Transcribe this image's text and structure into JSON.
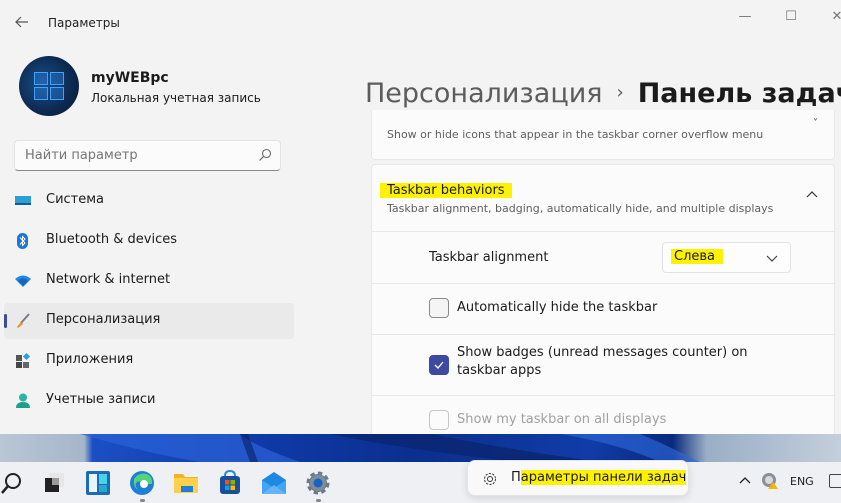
{
  "window": {
    "title": "Параметры",
    "controls": {
      "minimize": "—",
      "maximize": "☐",
      "close": "✕"
    }
  },
  "profile": {
    "name": "myWEBpc",
    "account_type": "Локальная учетная запись"
  },
  "search": {
    "placeholder": "Найти параметр",
    "value": ""
  },
  "sidebar": {
    "items": [
      {
        "label": "Система",
        "icon": "system-icon",
        "active": false
      },
      {
        "label": "Bluetooth & devices",
        "icon": "bluetooth-icon",
        "active": false
      },
      {
        "label": "Network & internet",
        "icon": "wifi-icon",
        "active": false
      },
      {
        "label": "Персонализация",
        "icon": "brush-icon",
        "active": true
      },
      {
        "label": "Приложения",
        "icon": "apps-icon",
        "active": false
      },
      {
        "label": "Учетные записи",
        "icon": "account-icon",
        "active": false
      }
    ]
  },
  "breadcrumb": {
    "parent": "Персонализация",
    "separator": "›",
    "current": "Панель задач"
  },
  "overflow_card": {
    "description": "Show or hide icons that appear in the taskbar corner overflow menu"
  },
  "behaviors": {
    "title": "Taskbar behaviors",
    "description": "Taskbar alignment, badging, automatically hide, and multiple displays",
    "expanded": true,
    "alignment": {
      "label": "Taskbar alignment",
      "selected": "Слева"
    },
    "options": [
      {
        "label": "Automatically hide the taskbar",
        "checked": false,
        "disabled": false
      },
      {
        "label": "Show badges (unread messages counter) on taskbar apps",
        "checked": true,
        "disabled": false
      },
      {
        "label": "Show my taskbar on all displays",
        "checked": false,
        "disabled": true
      }
    ]
  },
  "taskbar": {
    "apps": [
      {
        "name": "search",
        "running": false
      },
      {
        "name": "task-view",
        "running": false
      },
      {
        "name": "widgets",
        "running": false
      },
      {
        "name": "edge",
        "running": true
      },
      {
        "name": "file-explorer",
        "running": false
      },
      {
        "name": "microsoft-store",
        "running": false
      },
      {
        "name": "mail",
        "running": false
      },
      {
        "name": "settings",
        "running": true
      }
    ],
    "context_menu": {
      "label_prefix": "П",
      "label_rest": "араметры панели задач"
    },
    "tray": {
      "language": "ENG"
    }
  },
  "colors": {
    "accent": "#3d4aa0",
    "highlight": "#fff200"
  }
}
